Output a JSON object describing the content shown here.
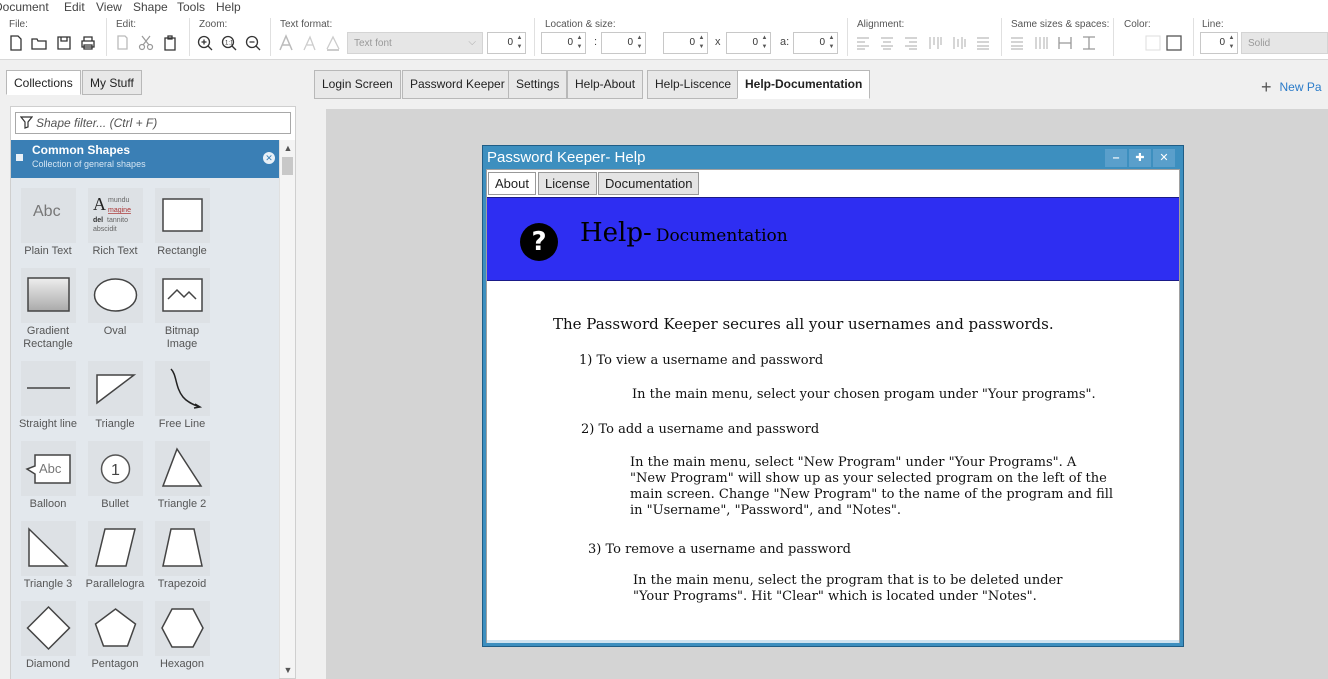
{
  "menu": [
    "Document",
    "Edit",
    "View",
    "Shape",
    "Tools",
    "Help"
  ],
  "toolbar": {
    "file_label": "File:",
    "edit_label": "Edit:",
    "zoom_label": "Zoom:",
    "text_format_label": "Text format:",
    "font_value": "Text font",
    "font_size": "0",
    "location_label": "Location & size:",
    "loc_x": "0",
    "loc_y": "0",
    "loc_sep": ":",
    "width": "0",
    "height": "0",
    "size_sep": "x",
    "angle_label": "a:",
    "angle": "0",
    "alignment_label": "Alignment:",
    "same_sizes_label": "Same sizes & spaces:",
    "color_label": "Color:",
    "line_label": "Line:",
    "line_width": "0",
    "line_style": "Solid"
  },
  "left": {
    "tab_collections": "Collections",
    "tab_mystuff": "My Stuff",
    "filter_placeholder": "Shape filter... (Ctrl + F)",
    "group_title": "Common Shapes",
    "group_subtitle": "Collection of general shapes",
    "shapes": [
      {
        "label": "Plain Text"
      },
      {
        "label": "Rich Text"
      },
      {
        "label": "Rectangle"
      },
      {
        "label": "Gradient Rectangle"
      },
      {
        "label": "Oval"
      },
      {
        "label": "Bitmap Image"
      },
      {
        "label": "Straight line"
      },
      {
        "label": "Triangle"
      },
      {
        "label": "Free Line"
      },
      {
        "label": "Balloon"
      },
      {
        "label": "Bullet"
      },
      {
        "label": "Triangle 2"
      },
      {
        "label": "Triangle 3"
      },
      {
        "label": "Parallelogra"
      },
      {
        "label": "Trapezoid"
      },
      {
        "label": "Diamond"
      },
      {
        "label": "Pentagon"
      },
      {
        "label": "Hexagon"
      }
    ],
    "icon_texts": {
      "plain_text": "Abc",
      "rich_a": "A",
      "rich_l1": "mundu",
      "rich_l2": "magine",
      "rich_l3": "del",
      "rich_l3b": "tannito",
      "rich_l4": "abscidit",
      "balloon": "Abc",
      "bullet": "1"
    }
  },
  "doc_tabs": [
    {
      "label": "Login Screen"
    },
    {
      "label": "Password Keeper"
    },
    {
      "label": "Settings"
    },
    {
      "label": "Help-About"
    },
    {
      "label": "Help-Liscence"
    },
    {
      "label": "Help-Documentation",
      "active": true
    }
  ],
  "new_page": "New Pa",
  "dialog": {
    "title": "Password Keeper- Help",
    "tabs": [
      {
        "label": "About",
        "active": true
      },
      {
        "label": "License"
      },
      {
        "label": "Documentation"
      }
    ],
    "banner_title": "Help-",
    "banner_subtitle": "Documentation",
    "intro": "The Password Keeper secures all your usernames and passwords.",
    "s1_title": "1) To view a username and password",
    "s1_text": "In the main menu, select your chosen progam under \"Your programs\".",
    "s2_title": "2) To add a username and password",
    "s2_l1": "In the main menu, select \"New Program\" under \"Your Programs\". A",
    "s2_l2": "\"New Program\" will show up as your selected program on the left of the",
    "s2_l3": "main screen. Change \"New Program\" to the name of the program and fill",
    "s2_l4": "in \"Username\", \"Password\", and \"Notes\".",
    "s3_title": "3) To remove a username and password",
    "s3_l1": "In the main menu, select the program that is to be deleted under",
    "s3_l2": "\"Your Programs\". Hit \"Clear\" which is located under \"Notes\"."
  },
  "colors": {
    "banner": "#2e2ef2",
    "titlebar": "#3d8fbf",
    "accent": "#3a7fb5",
    "new_page": "#2a7bc9"
  }
}
